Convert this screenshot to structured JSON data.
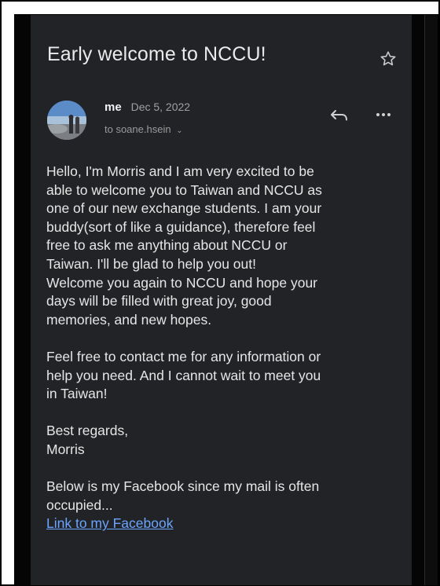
{
  "email": {
    "subject": "Early welcome to NCCU!",
    "sender": "me",
    "date": "Dec 5, 2022",
    "recipient": "to soane.hsein",
    "icons": {
      "star": "star-icon",
      "reply": "reply-icon",
      "more": "more-icon",
      "chevron": "chevron-down-icon"
    },
    "body": {
      "paragraph1": [
        "Hello, I'm Morris and I am very excited to be",
        "able to welcome you to Taiwan and NCCU as",
        "one of our new exchange students. I am your",
        "buddy(sort of like a guidance), therefore feel",
        "free to ask me anything about NCCU or",
        "Taiwan. I'll be glad to help you out!",
        "Welcome you again to NCCU and hope your",
        "days will be filled with great joy, good",
        "memories, and new hopes."
      ],
      "paragraph2": [
        "Feel free to contact me for any information or",
        "help you need. And I cannot wait to meet you",
        "in Taiwan!"
      ],
      "paragraph3": [
        "Best regards,",
        "Morris"
      ],
      "paragraph4": [
        "Below is my Facebook since my mail is often",
        "occupied..."
      ],
      "link_text": "Link to my Facebook"
    }
  },
  "colors": {
    "background": "#222326",
    "text": "#e6e6e6",
    "link": "#6aa5ff"
  }
}
